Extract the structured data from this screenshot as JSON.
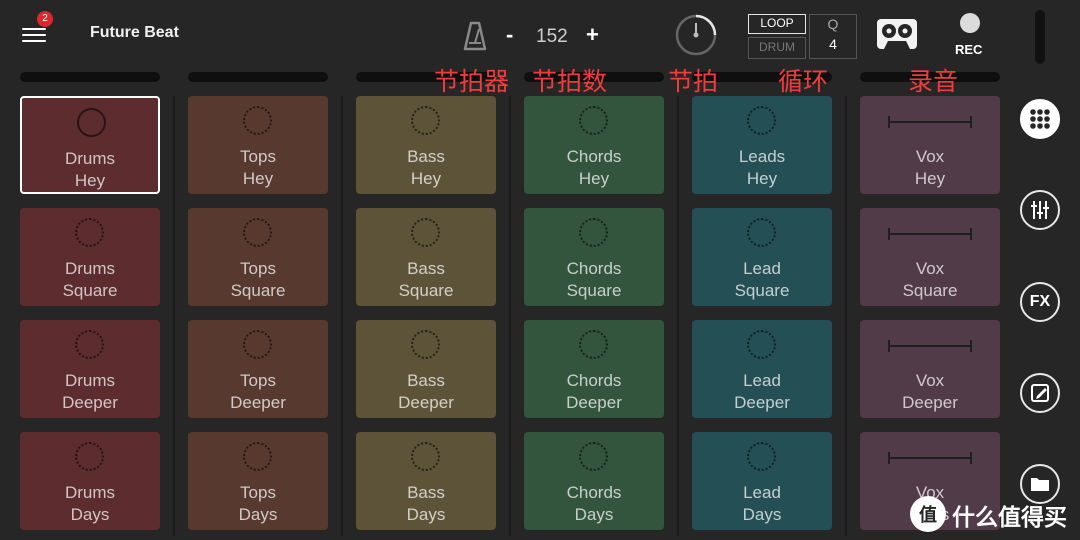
{
  "header": {
    "menu_badge": "2",
    "title": "Future Beat",
    "bpm_minus": "-",
    "bpm_value": "152",
    "bpm_plus": "+",
    "loop_label": "LOOP",
    "drum_label": "DRUM",
    "q_label": "Q",
    "q_value": "4",
    "rec_label": "REC"
  },
  "annotations": {
    "metronome": "节拍器",
    "bpm": "节拍数",
    "beat": "节拍",
    "loop": "循环",
    "record": "录音"
  },
  "columns": [
    {
      "name": "Drums",
      "color": "#5c2c2f",
      "pads": [
        {
          "l1": "Drums",
          "l2": "Hey"
        },
        {
          "l1": "Drums",
          "l2": "Square"
        },
        {
          "l1": "Drums",
          "l2": "Deeper"
        },
        {
          "l1": "Drums",
          "l2": "Days"
        }
      ]
    },
    {
      "name": "Tops",
      "color": "#583930",
      "pads": [
        {
          "l1": "Tops",
          "l2": "Hey"
        },
        {
          "l1": "Tops",
          "l2": "Square"
        },
        {
          "l1": "Tops",
          "l2": "Deeper"
        },
        {
          "l1": "Tops",
          "l2": "Days"
        }
      ]
    },
    {
      "name": "Bass",
      "color": "#5d5338",
      "pads": [
        {
          "l1": "Bass",
          "l2": "Hey"
        },
        {
          "l1": "Bass",
          "l2": "Square"
        },
        {
          "l1": "Bass",
          "l2": "Deeper"
        },
        {
          "l1": "Bass",
          "l2": "Days"
        }
      ]
    },
    {
      "name": "Chords",
      "color": "#33553d",
      "pads": [
        {
          "l1": "Chords",
          "l2": "Hey"
        },
        {
          "l1": "Chords",
          "l2": "Square"
        },
        {
          "l1": "Chords",
          "l2": "Deeper"
        },
        {
          "l1": "Chords",
          "l2": "Days"
        }
      ]
    },
    {
      "name": "Leads",
      "color": "#244f55",
      "pads": [
        {
          "l1": "Leads",
          "l2": "Hey"
        },
        {
          "l1": "Lead",
          "l2": "Square"
        },
        {
          "l1": "Lead",
          "l2": "Deeper"
        },
        {
          "l1": "Lead",
          "l2": "Days"
        }
      ]
    },
    {
      "name": "Vox",
      "color": "#513b48",
      "pads": [
        {
          "l1": "Vox",
          "l2": "Hey"
        },
        {
          "l1": "Vox",
          "l2": "Square"
        },
        {
          "l1": "Vox",
          "l2": "Deeper"
        },
        {
          "l1": "Vox",
          "l2": "Days"
        }
      ]
    }
  ],
  "selected_pad": "Drums Hey",
  "sidebar": {
    "fx_label": "FX",
    "icons": [
      "grid-icon",
      "mixer-sliders-icon",
      "fx-icon",
      "edit-icon",
      "folder-icon"
    ]
  },
  "watermark": {
    "text": "什么值得买",
    "logo_text": "值"
  }
}
